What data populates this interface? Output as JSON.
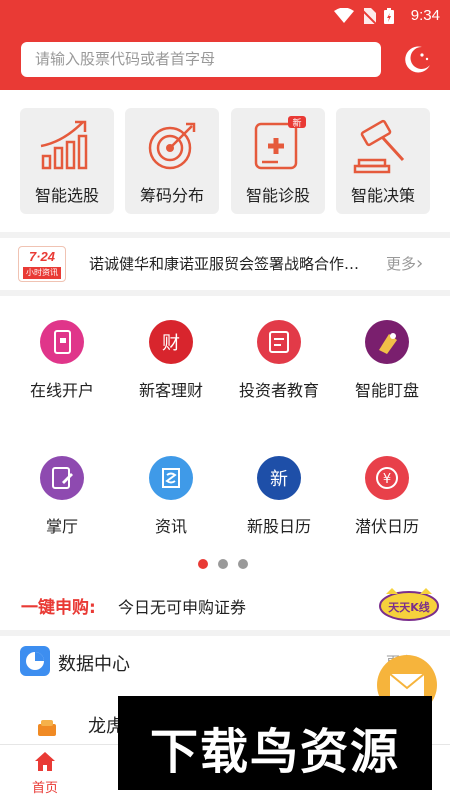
{
  "status_bar": {
    "time": "9:34"
  },
  "header": {
    "search_placeholder": "请输入股票代码或者首字母",
    "theme_icon": "moon-icon"
  },
  "tools": [
    {
      "label": "智能选股",
      "icon": "stock-picker-icon"
    },
    {
      "label": "筹码分布",
      "icon": "chip-distribution-icon"
    },
    {
      "label": "智能诊股",
      "icon": "stock-diagnosis-icon",
      "badge": "新"
    },
    {
      "label": "智能决策",
      "icon": "decision-gavel-icon"
    }
  ],
  "news": {
    "badge_top": "7·24",
    "badge_bottom": "小时资讯",
    "headline": "诺诚健华和康诺亚服贸会签署战略合作协议",
    "more": "更多",
    "more_icon": "chevron-right-icon"
  },
  "services": [
    {
      "label": "在线开户",
      "color": "#e0358a",
      "icon": "open-account-icon"
    },
    {
      "label": "新客理财",
      "color": "#d8252d",
      "icon_text": "财",
      "icon": "finance-icon"
    },
    {
      "label": "投资者教育",
      "color": "#e23a48",
      "icon": "education-icon"
    },
    {
      "label": "智能盯盘",
      "color": "#7a1f6e",
      "icon": "monitor-icon"
    },
    {
      "label": "掌厅",
      "color": "#8e4ab0",
      "icon": "hall-icon"
    },
    {
      "label": "资讯",
      "color": "#3f9ae8",
      "icon": "news-icon"
    },
    {
      "label": "新股日历",
      "color": "#1e4fa8",
      "icon_text": "新",
      "icon": "ipo-calendar-icon"
    },
    {
      "label": "潜伏日历",
      "color": "#e8404a",
      "icon": "lurk-calendar-icon"
    }
  ],
  "pager": {
    "count": 3,
    "active": 0
  },
  "ipo": {
    "label": "一键申购:",
    "text": "今日无可申购证券",
    "game_badge": "天天K线"
  },
  "data_center": {
    "title": "数据中心",
    "more": "更多",
    "icon": "pie-chart-icon",
    "row_text": "龙虎"
  },
  "tabbar": {
    "home_label": "首页",
    "home_icon": "home-icon"
  },
  "watermark": "下载鸟资源",
  "colors": {
    "brand_red": "#e93a35",
    "bg_gray": "#f2f2f2"
  }
}
